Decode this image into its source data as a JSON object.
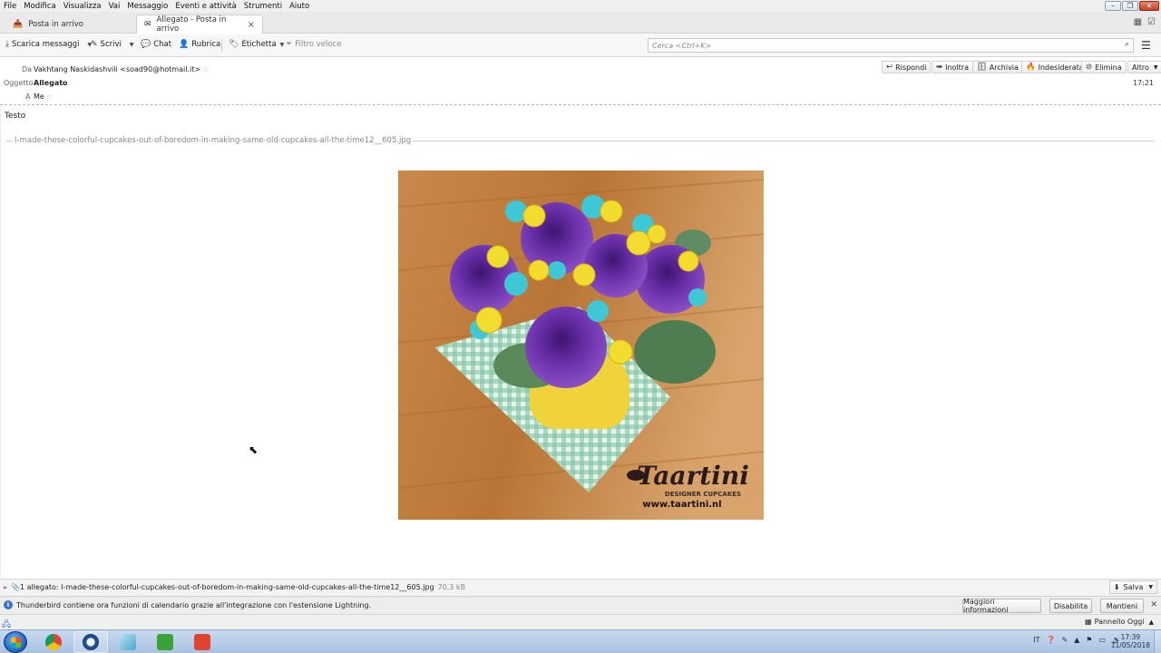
{
  "menu": [
    "File",
    "Modifica",
    "Visualizza",
    "Vai",
    "Messaggio",
    "Eventi e attività",
    "Strumenti",
    "Aiuto"
  ],
  "tabs": [
    {
      "label": "Posta in arrivo",
      "icon": "inbox-icon"
    },
    {
      "label": "Allegato - Posta in arrivo",
      "icon": "envelope-icon"
    }
  ],
  "toolbar": {
    "get_messages": "Scarica messaggi",
    "write": "Scrivi",
    "chat": "Chat",
    "address_book": "Rubrica",
    "tag": "Etichetta",
    "quick_filter": "Filtro veloce",
    "search_placeholder": "Cerca <Ctrl+K>"
  },
  "header": {
    "from_label": "Da",
    "from_value": "Vakhtang Naskidashvili <soad90@hotmail.it>",
    "subject_label": "Oggetto",
    "subject_value": "Allegato",
    "to_label": "A",
    "to_value": "Me",
    "time": "17:21",
    "actions": {
      "reply": "Rispondi",
      "forward": "Inoltra",
      "archive": "Archivia",
      "junk": "Indesiderata",
      "delete": "Elimina",
      "more": "Altro"
    }
  },
  "body": {
    "text": "Testo",
    "attachment_name": "I-made-these-colorful-cupcakes-out-of-boredom-in-making-same-old-cupcakes-all-the-time12__605.jpg"
  },
  "image_watermark": {
    "brand": "Taartini",
    "tagline": "DESIGNER CUPCAKES",
    "url": "www.taartini.nl"
  },
  "attachment_bar": {
    "label": "1 allegato: I-made-these-colorful-cupcakes-out-of-boredom-in-making-same-old-cupcakes-all-the-time12__605.jpg",
    "size": "70,3 kB",
    "save": "Salva"
  },
  "notification": {
    "message": "Thunderbird contiene ora funzioni di calendario grazie all'integrazione con l'estensione Lightning.",
    "more_info": "Maggiori informazioni",
    "disable": "Disabilita",
    "keep": "Mantieni"
  },
  "status": {
    "today_pane": "Pannello Oggi"
  },
  "taskbar": {
    "lang": "IT",
    "time": "17:39",
    "date": "11/05/2018"
  },
  "colors": {
    "accent": "#3b73c9",
    "close_red": "#c2402a"
  }
}
